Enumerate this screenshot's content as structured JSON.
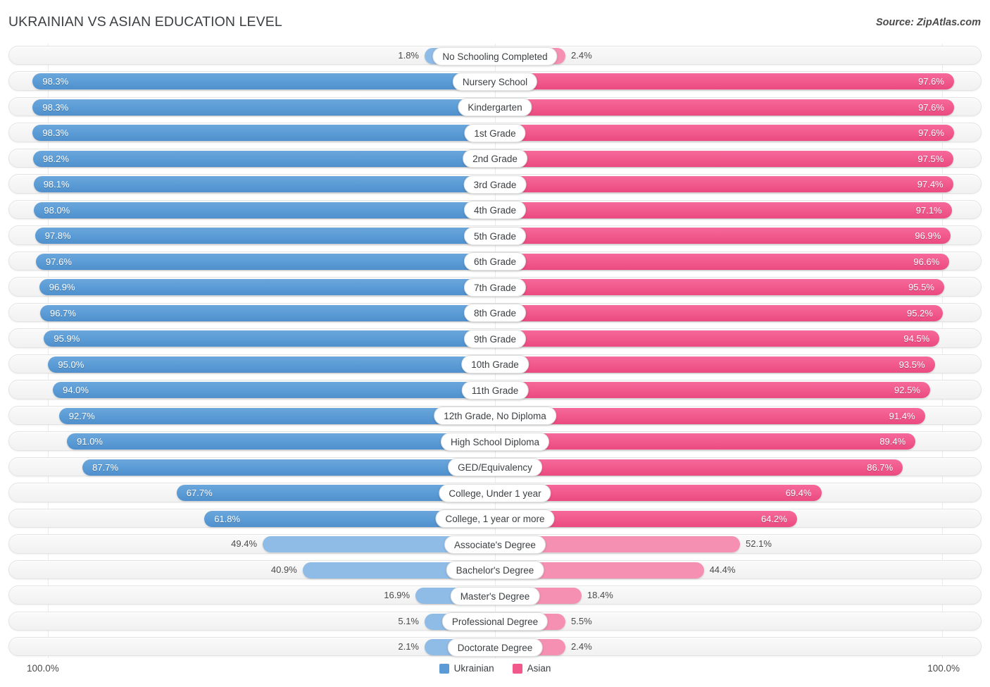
{
  "header": {
    "title": "UKRAINIAN VS ASIAN EDUCATION LEVEL",
    "source": "Source: ZipAtlas.com"
  },
  "legend": {
    "left_label": "Ukrainian",
    "right_label": "Asian",
    "left_color": "#5b9bd5",
    "right_color": "#f1588b"
  },
  "axis": {
    "left_max": "100.0%",
    "right_max": "100.0%"
  },
  "colors": {
    "blue_strong": "#5b9bd5",
    "blue_light": "#8fbce7",
    "pink_strong": "#f1588b",
    "pink_light": "#f590b3",
    "track": "#f5f5f5",
    "track_border": "#e3e3e3"
  },
  "chart_data": {
    "type": "bar",
    "title": "UKRAINIAN VS ASIAN EDUCATION LEVEL",
    "subtitle": "",
    "xlabel": "",
    "ylabel": "",
    "orientation": "horizontal-diverging",
    "xlim": [
      0,
      100
    ],
    "grid": false,
    "legend_position": "bottom-center",
    "categories": [
      "No Schooling Completed",
      "Nursery School",
      "Kindergarten",
      "1st Grade",
      "2nd Grade",
      "3rd Grade",
      "4th Grade",
      "5th Grade",
      "6th Grade",
      "7th Grade",
      "8th Grade",
      "9th Grade",
      "10th Grade",
      "11th Grade",
      "12th Grade, No Diploma",
      "High School Diploma",
      "GED/Equivalency",
      "College, Under 1 year",
      "College, 1 year or more",
      "Associate's Degree",
      "Bachelor's Degree",
      "Master's Degree",
      "Professional Degree",
      "Doctorate Degree"
    ],
    "series": [
      {
        "name": "Ukrainian",
        "color": "#5b9bd5",
        "values": [
          1.8,
          98.3,
          98.3,
          98.3,
          98.2,
          98.1,
          98.0,
          97.8,
          97.6,
          96.9,
          96.7,
          95.9,
          95.0,
          94.0,
          92.7,
          91.0,
          87.7,
          67.7,
          61.8,
          49.4,
          40.9,
          16.9,
          5.1,
          2.1
        ]
      },
      {
        "name": "Asian",
        "color": "#f1588b",
        "values": [
          2.4,
          97.6,
          97.6,
          97.6,
          97.5,
          97.4,
          97.1,
          96.9,
          96.6,
          95.5,
          95.2,
          94.5,
          93.5,
          92.5,
          91.4,
          89.4,
          86.7,
          69.4,
          64.2,
          52.1,
          44.4,
          18.4,
          5.5,
          2.4
        ]
      }
    ]
  },
  "rows": [
    {
      "label": "No Schooling Completed",
      "left": "1.8%",
      "right": "2.4%"
    },
    {
      "label": "Nursery School",
      "left": "98.3%",
      "right": "97.6%"
    },
    {
      "label": "Kindergarten",
      "left": "98.3%",
      "right": "97.6%"
    },
    {
      "label": "1st Grade",
      "left": "98.3%",
      "right": "97.6%"
    },
    {
      "label": "2nd Grade",
      "left": "98.2%",
      "right": "97.5%"
    },
    {
      "label": "3rd Grade",
      "left": "98.1%",
      "right": "97.4%"
    },
    {
      "label": "4th Grade",
      "left": "98.0%",
      "right": "97.1%"
    },
    {
      "label": "5th Grade",
      "left": "97.8%",
      "right": "96.9%"
    },
    {
      "label": "6th Grade",
      "left": "97.6%",
      "right": "96.6%"
    },
    {
      "label": "7th Grade",
      "left": "96.9%",
      "right": "95.5%"
    },
    {
      "label": "8th Grade",
      "left": "96.7%",
      "right": "95.2%"
    },
    {
      "label": "9th Grade",
      "left": "95.9%",
      "right": "94.5%"
    },
    {
      "label": "10th Grade",
      "left": "95.0%",
      "right": "93.5%"
    },
    {
      "label": "11th Grade",
      "left": "94.0%",
      "right": "92.5%"
    },
    {
      "label": "12th Grade, No Diploma",
      "left": "92.7%",
      "right": "91.4%"
    },
    {
      "label": "High School Diploma",
      "left": "91.0%",
      "right": "89.4%"
    },
    {
      "label": "GED/Equivalency",
      "left": "87.7%",
      "right": "86.7%"
    },
    {
      "label": "College, Under 1 year",
      "left": "67.7%",
      "right": "69.4%"
    },
    {
      "label": "College, 1 year or more",
      "left": "61.8%",
      "right": "64.2%"
    },
    {
      "label": "Associate's Degree",
      "left": "49.4%",
      "right": "52.1%"
    },
    {
      "label": "Bachelor's Degree",
      "left": "40.9%",
      "right": "44.4%"
    },
    {
      "label": "Master's Degree",
      "left": "16.9%",
      "right": "18.4%"
    },
    {
      "label": "Professional Degree",
      "left": "5.1%",
      "right": "5.5%"
    },
    {
      "label": "Doctorate Degree",
      "left": "2.1%",
      "right": "2.4%"
    }
  ]
}
